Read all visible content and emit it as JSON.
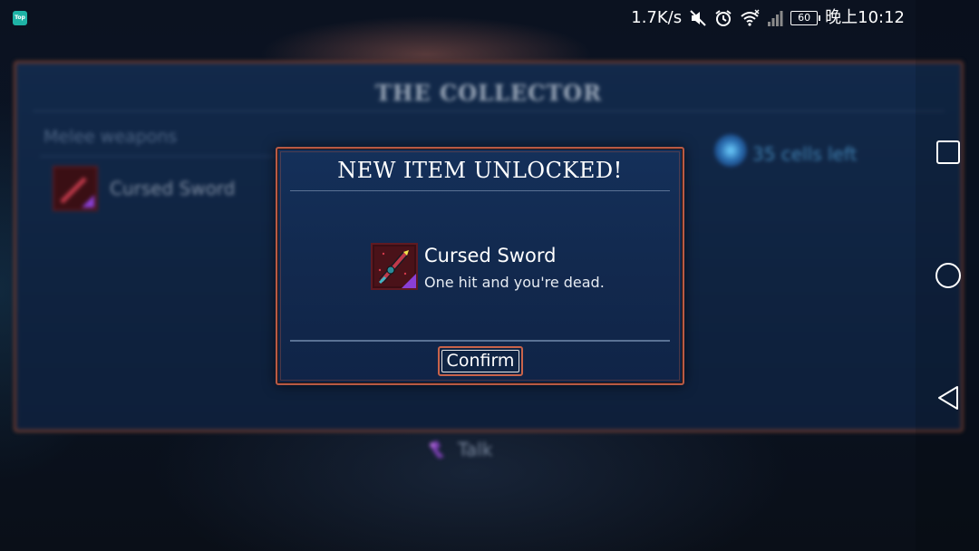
{
  "status_bar": {
    "app_badge": "Top",
    "net_speed": "1.7K/s",
    "battery": "60",
    "time": "晚上10:12",
    "icons": [
      "mute-icon",
      "alarm-icon",
      "wifi-icon",
      "signal-icon",
      "battery-icon"
    ]
  },
  "background": {
    "panel_title": "THE COLLECTOR",
    "category_label": "Melee weapons",
    "list_item": "Cursed Sword",
    "cells_left": "35 cells left",
    "talk_label": "Talk"
  },
  "dialog": {
    "title": "NEW ITEM UNLOCKED!",
    "item_name": "Cursed Sword",
    "item_description": "One hit and you're dead.",
    "confirm_label": "Confirm"
  },
  "nav_bar": {
    "buttons": [
      "recents-button",
      "home-button",
      "back-button"
    ]
  },
  "colors": {
    "dialog_border": "#b85a45",
    "dialog_bg": "#14305a",
    "confirm_border": "#c9634a",
    "rarity_purple": "#8a3fd6"
  }
}
